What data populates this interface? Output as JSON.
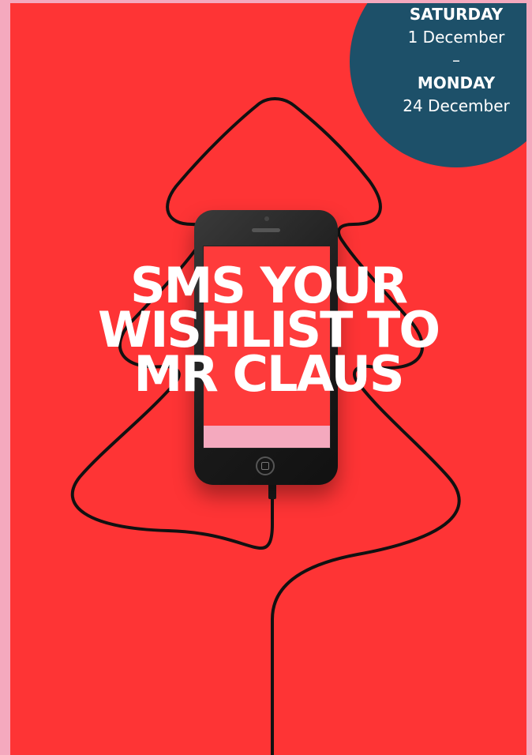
{
  "poster": {
    "headline": [
      "SMS YOUR",
      "WISHLIST TO",
      "MR CLAUS"
    ],
    "colors": {
      "background": "#fe3435",
      "frame": "#f4a9be",
      "badge": "#1d5069",
      "text": "#ffffff"
    }
  },
  "dates": {
    "start_day": "SATURDAY",
    "start_date": "1 December",
    "separator": "–",
    "end_day": "MONDAY",
    "end_date": "24 December"
  },
  "icons": {
    "tree": "christmas-tree-cable-icon",
    "phone": "smartphone-icon",
    "home": "home-button-icon"
  }
}
